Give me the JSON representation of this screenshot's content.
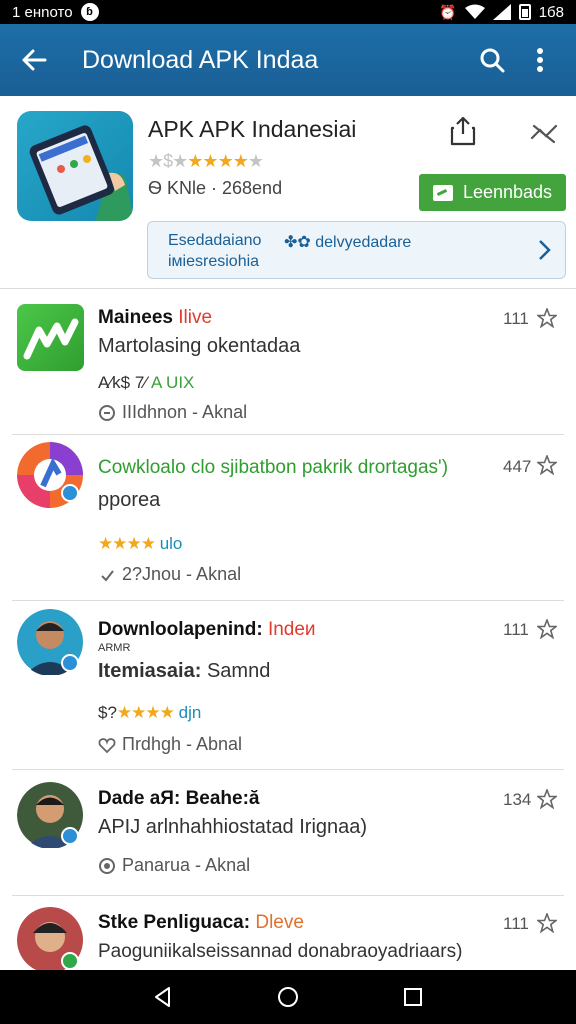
{
  "status_bar": {
    "time": "1 енnото",
    "right_text": "1б8"
  },
  "app_bar": {
    "title": "Download APK Indaa"
  },
  "header": {
    "app_name": "APK APK Indanesiai",
    "rating_prefix": "★$★",
    "rating_stars": "★★★★",
    "rating_empty": "★",
    "meta": "Ѳ KNle · 268end",
    "download_label": "Leennbads",
    "banner": {
      "line1": "Esedadaiano",
      "line2": "іміеsresiohia",
      "mid": "✤✿ delvyedadare"
    }
  },
  "rows": [
    {
      "title": "Mainees",
      "title_accent": "Ilive",
      "accent_color": "#e03b2c",
      "subtitle": "Martolasing okentadaa",
      "rating_text": "A⁄k$ 7⁄ ",
      "rating_accent": "A UIX",
      "rating_accent_color": "#3aa03a",
      "author": "IIIdhnon - Aknal",
      "count": "111"
    },
    {
      "title": "Cowkloalo clo sjibatbon pakrik drortagas')",
      "title_color": "#2f9e2f",
      "subtitle": "pporea",
      "rating_stars": "★★★★",
      "rating_accent": "ulo",
      "rating_accent_color": "#1a8fb8",
      "author": "2?Jnou - Aknal",
      "count": "447"
    },
    {
      "title": "Downloolapenind:",
      "title_accent": "Indeи",
      "accent_color": "#e03b2c",
      "small_label": "ARMR",
      "subtitle_bold": "Itemiasaia:",
      "subtitle": "Samnd",
      "rating_prefix": "$?",
      "rating_stars": "★★★★",
      "rating_accent": "djn",
      "rating_accent_color": "#1a8fb8",
      "author": "Пrdhgh - Abnal",
      "count": "111"
    },
    {
      "title": "Dade aЯ: Beahe:ă",
      "subtitle": "APIJ arlnhahhiostatad Irignaa)",
      "author": "Panarua - Aknal",
      "count": "134"
    },
    {
      "title": "Stke Penliguaca:",
      "title_accent": "Dleve",
      "accent_color": "#e0722c",
      "subtitle": "Paoguniikalseissannad donabraoyadriaars)",
      "count": "111"
    }
  ]
}
